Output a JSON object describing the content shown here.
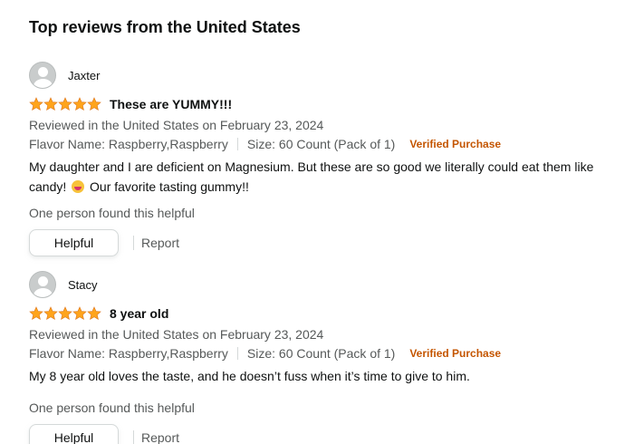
{
  "section": {
    "heading": "Top reviews from the United States"
  },
  "colors": {
    "star": "#ffa41c",
    "verified": "#c45500",
    "secondary_text": "#565959"
  },
  "reviews": [
    {
      "reviewer": "Jaxter",
      "rating": 5,
      "title": "These are YUMMY!!!",
      "date": "Reviewed in the United States on February 23, 2024",
      "flavor": "Flavor Name: Raspberry,Raspberry",
      "size": "Size: 60 Count (Pack of 1)",
      "verified": "Verified Purchase",
      "body_before_emoji": "My daughter and I are deficient on Magnesium. But these are so good we literally could eat them like candy! ",
      "body_emoji": "laughing-face-emoji",
      "body_after_emoji": " Our favorite tasting gummy!!",
      "helpful_count": "One person found this helpful",
      "helpful_button": "Helpful",
      "report": "Report"
    },
    {
      "reviewer": "Stacy",
      "rating": 5,
      "title": "8 year old",
      "date": "Reviewed in the United States on February 23, 2024",
      "flavor": "Flavor Name: Raspberry,Raspberry",
      "size": "Size: 60 Count (Pack of 1)",
      "verified": "Verified Purchase",
      "body": "My 8 year old loves the taste, and he doesn’t fuss when it’s time to give to him.",
      "helpful_count": "One person found this helpful",
      "helpful_button": "Helpful",
      "report": "Report"
    }
  ]
}
